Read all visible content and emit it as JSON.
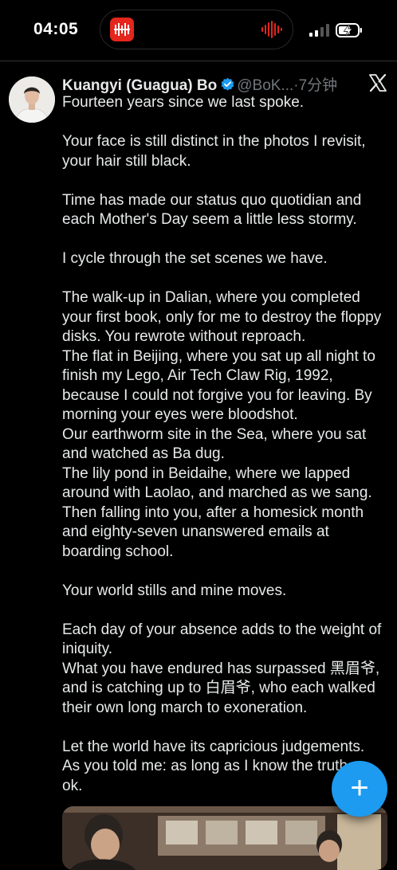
{
  "status_bar": {
    "time": "04:05"
  },
  "post": {
    "author_name": "Kuangyi (Guagua) Bo",
    "handle": "@BoK...",
    "separator": "·",
    "timestamp": "7分钟",
    "lines": [
      "Fourteen years since we last spoke.",
      "",
      "Your face is still distinct in the photos I revisit,",
      "your hair still black.",
      "",
      "Time has made our status quo quotidian and",
      "each Mother's Day seem a little less stormy.",
      "",
      "I cycle through the set scenes we have.",
      "",
      "The walk-up in Dalian, where you completed",
      "your first book, only for me to destroy the floppy",
      "disks. You rewrote without reproach.",
      "The flat in Beijing, where you sat up all night to",
      "finish my Lego, Air Tech Claw Rig, 1992,",
      "because I could not forgive you for leaving. By",
      "morning your eyes were bloodshot.",
      "Our earthworm site in the Sea, where you sat",
      "and watched as Ba dug.",
      "The lily pond in Beidaihe, where we lapped",
      "around with Laolao, and marched as we sang.",
      "Then falling into you, after a homesick month",
      "and eighty-seven unanswered emails at",
      "boarding school.",
      "",
      "Your world stills and mine moves.",
      "",
      "Each day of your absence adds to the weight of",
      "iniquity.",
      "What you have endured has surpassed 黑眉爷,",
      "and is catching up to 白眉爷, who each walked",
      "their own long march to exoneration.",
      "",
      "Let the world have its capricious judgements.",
      "As you told me: as long as I know the truth",
      "ok."
    ]
  },
  "fab": {
    "label": "+"
  },
  "colors": {
    "background": "#000000",
    "text": "#e7e9ea",
    "secondary_text": "#71767b",
    "accent": "#1d9bf0",
    "recording_red": "#e4261d"
  },
  "icons": {
    "voice_memo": "voice-memo-app-icon",
    "waveform": "audio-waveform-icon",
    "signal": "cellular-signal-icon",
    "battery": "battery-charging-icon",
    "verified": "verified-badge-icon",
    "x_logo": "x-logo-icon",
    "compose": "plus-icon"
  }
}
